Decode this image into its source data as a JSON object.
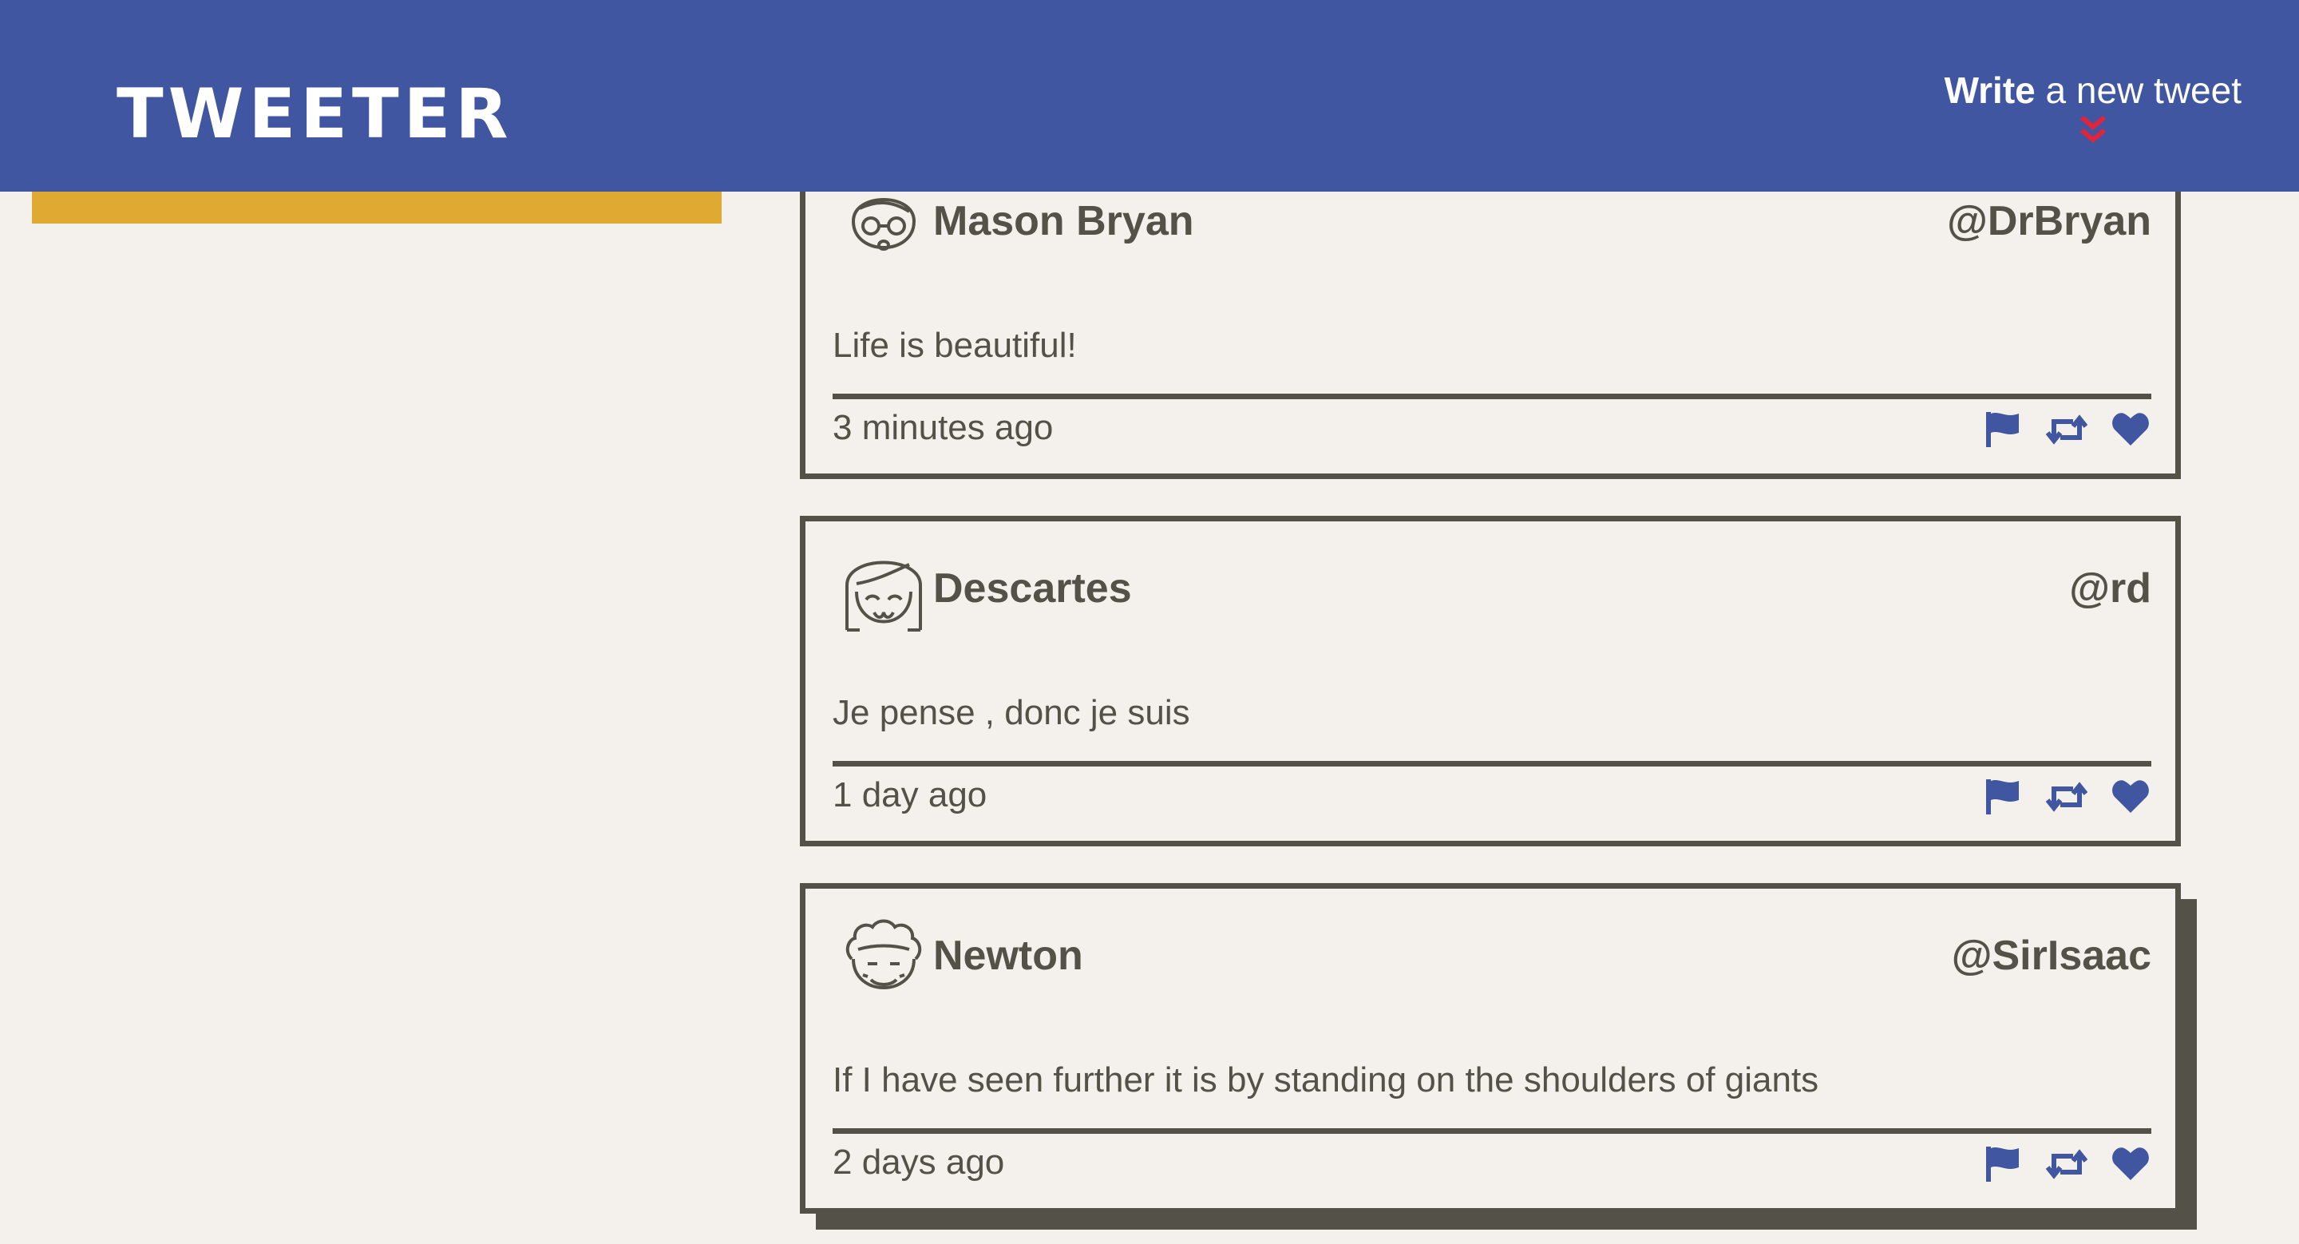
{
  "header": {
    "brand": "TWEETER",
    "compose_bold": "Write",
    "compose_rest": "a new tweet",
    "compose_icon": "double-chevron-down-icon",
    "accent_color": "#e0243a",
    "nav_color": "#4056a1"
  },
  "sidebar": {
    "banner_color": "#e0a932"
  },
  "tweets": [
    {
      "name": "Mason Bryan",
      "handle": "@DrBryan",
      "content": "Life is beautiful!",
      "time": "3 minutes ago",
      "avatar": "glasses-face-icon"
    },
    {
      "name": "Descartes",
      "handle": "@rd",
      "content": "Je pense , donc je suis",
      "time": "1 day ago",
      "avatar": "bob-hair-face-icon"
    },
    {
      "name": "Newton",
      "handle": "@SirIsaac",
      "content": "If I have seen further it is by standing on the shoulders of giants",
      "time": "2 days ago",
      "avatar": "curly-hair-face-icon"
    }
  ],
  "action_icons": [
    "flag-icon",
    "retweet-icon",
    "heart-icon"
  ],
  "action_color": "#4056a1"
}
